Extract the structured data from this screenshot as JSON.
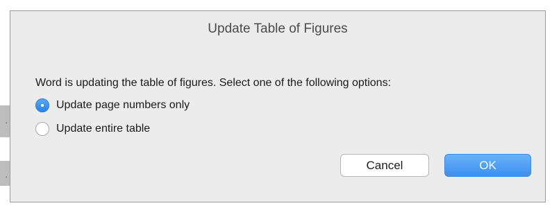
{
  "dialog": {
    "title": "Update Table of Figures",
    "message": "Word is updating the table of figures.  Select one of the following options:",
    "options": [
      {
        "label": "Update page numbers only",
        "selected": true
      },
      {
        "label": "Update entire table",
        "selected": false
      }
    ],
    "buttons": {
      "cancel_label": "Cancel",
      "ok_label": "OK"
    }
  },
  "colors": {
    "accent": "#3b8ff0",
    "dialog_background": "#ececec"
  }
}
